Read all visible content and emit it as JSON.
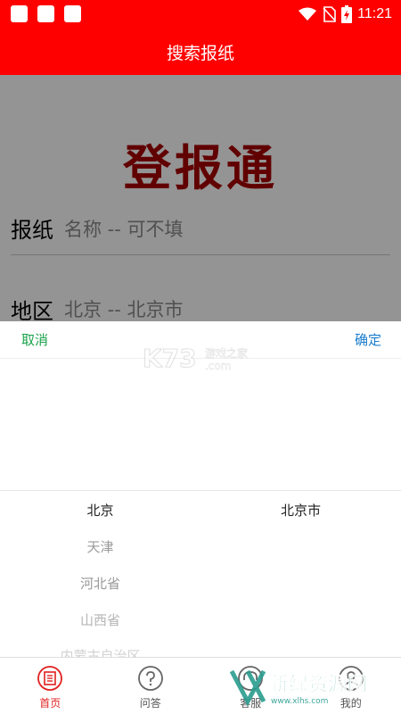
{
  "status_bar": {
    "time": "11:21"
  },
  "header": {
    "title": "搜索报纸"
  },
  "form": {
    "brand": "登报通",
    "newspaper_label": "报纸",
    "newspaper_placeholder": "名称 -- 可不填",
    "region_label": "地区",
    "region_value": "北京 -- 北京市"
  },
  "picker": {
    "cancel_label": "取消",
    "confirm_label": "确定",
    "provinces": [
      "北京",
      "天津",
      "河北省",
      "山西省",
      "内蒙古自治区"
    ],
    "cities": [
      "北京市"
    ]
  },
  "tabs": [
    {
      "label": "首页",
      "icon": "newspaper-icon",
      "active": true
    },
    {
      "label": "问答",
      "icon": "question-icon",
      "active": false
    },
    {
      "label": "客服",
      "icon": "headset-icon",
      "active": false
    },
    {
      "label": "我的",
      "icon": "user-icon",
      "active": false
    }
  ],
  "watermarks": {
    "top_text": "游戏之家",
    "top_domain": ".com",
    "bottom_text": "新绿资源网",
    "bottom_domain": "www.xlhs.com"
  },
  "colors": {
    "accent_red": "#ff0000",
    "brand_red": "#a80000",
    "cancel_green": "#1aa34a",
    "confirm_blue": "#1a7ccc"
  }
}
